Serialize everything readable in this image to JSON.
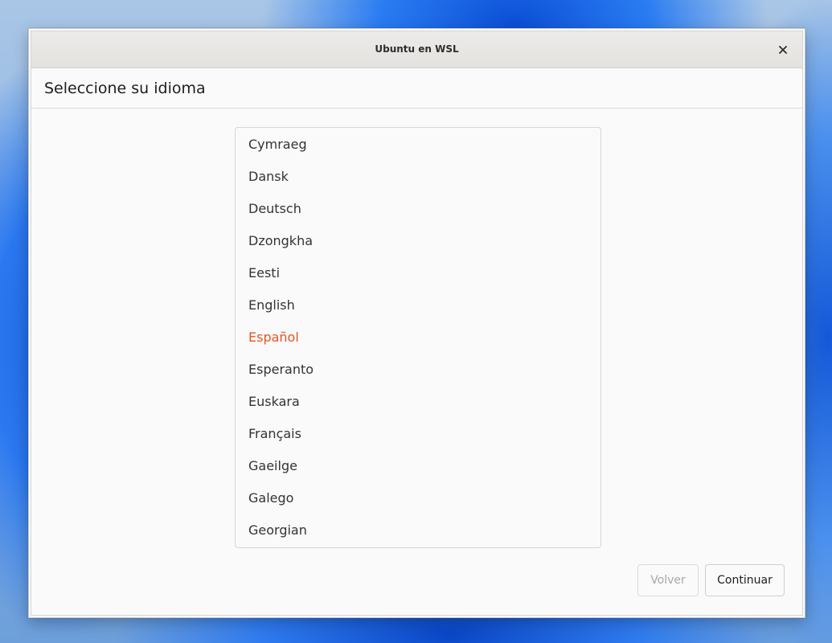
{
  "window": {
    "title": "Ubuntu en WSL",
    "close_icon": "close-icon"
  },
  "page": {
    "heading": "Seleccione su idioma"
  },
  "languages": {
    "items": [
      "Cymraeg",
      "Dansk",
      "Deutsch",
      "Dzongkha",
      "Eesti",
      "English",
      "Español",
      "Esperanto",
      "Euskara",
      "Français",
      "Gaeilge",
      "Galego",
      "Georgian"
    ],
    "selected": "Español",
    "selected_color": "#e95420"
  },
  "footer": {
    "back_label": "Volver",
    "continue_label": "Continuar"
  }
}
